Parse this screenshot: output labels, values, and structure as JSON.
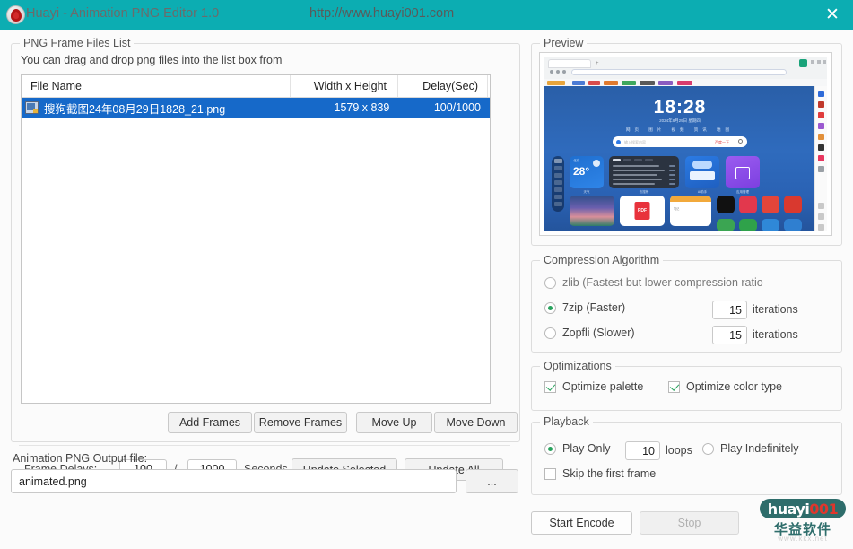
{
  "titlebar": {
    "app_title": "Huayi - Animation PNG Editor 1.0",
    "url": "http://www.huayi001.com",
    "close_label": "✕",
    "bg_color": "#0cadb2"
  },
  "files_panel": {
    "group_label": "PNG Frame Files List",
    "hint": "You can drag and drop png files into the list box from",
    "columns": [
      "File Name",
      "Width x Height",
      "Delay(Sec)"
    ],
    "rows": [
      {
        "name": "搜狗截图24年08月29日1828_21.png",
        "size": "1579 x 839",
        "delay": "100/1000"
      }
    ],
    "buttons": {
      "add": "Add Frames",
      "remove": "Remove Frames",
      "move_up": "Move Up",
      "move_down": "Move Down"
    },
    "delays": {
      "label": "Frame Delays:",
      "numerator": "100",
      "denominator": "1000",
      "slash": "/",
      "unit": "Seconds",
      "update_selected": "Update Selected",
      "update_all": "Update All"
    }
  },
  "output": {
    "label": "Animation PNG Output file:",
    "value": "animated.png",
    "placeholder": "animated.png",
    "browse_label": "..."
  },
  "preview": {
    "group_label": "Preview",
    "image": {
      "clock": "18:28",
      "date": "2024年8月29日 星期四",
      "nav_text": "网页  图片  视频  资讯  地图",
      "search_engine": "百度",
      "search_placeholder": "输入搜索内容",
      "search_button": "百度一下",
      "weather_temp": "28°",
      "weather_city": "北京",
      "weather_caption": "天气",
      "news_caption": "热搜榜",
      "ai_caption": "AI助手",
      "purple_caption": "应用管理",
      "pdf_label": "PDF",
      "note_caption": "笔记"
    }
  },
  "compression": {
    "group_label": "Compression Algorithm",
    "options": [
      {
        "label": "zlib (Fastest but lower compression ratio",
        "selected": false,
        "iterations": null
      },
      {
        "label": "7zip (Faster)",
        "selected": true,
        "iterations": "15"
      },
      {
        "label": "Zopfli (Slower)",
        "selected": false,
        "iterations": "15"
      }
    ],
    "iterations_label": "iterations"
  },
  "optimizations": {
    "group_label": "Optimizations",
    "palette": {
      "label": "Optimize palette",
      "checked": true
    },
    "color_type": {
      "label": "Optimize color type",
      "checked": true
    }
  },
  "playback": {
    "group_label": "Playback",
    "play_only": {
      "label": "Play Only",
      "selected": true
    },
    "loops_value": "10",
    "loops_label": "loops",
    "play_indefinitely": {
      "label": "Play Indefinitely",
      "selected": false
    },
    "skip_first": {
      "label": "Skip the first frame",
      "checked": false
    }
  },
  "actions": {
    "start_encode": "Start Encode",
    "stop": "Stop",
    "stop_enabled": false
  },
  "watermark": {
    "brand": "huayi",
    "brand_suffix": "001",
    "chinese": "华益软件",
    "sub": "www.kkx.net"
  },
  "colors": {
    "accent_teal": "#0cadb2",
    "selection_blue": "#1669c9",
    "check_green": "#27a25c"
  }
}
